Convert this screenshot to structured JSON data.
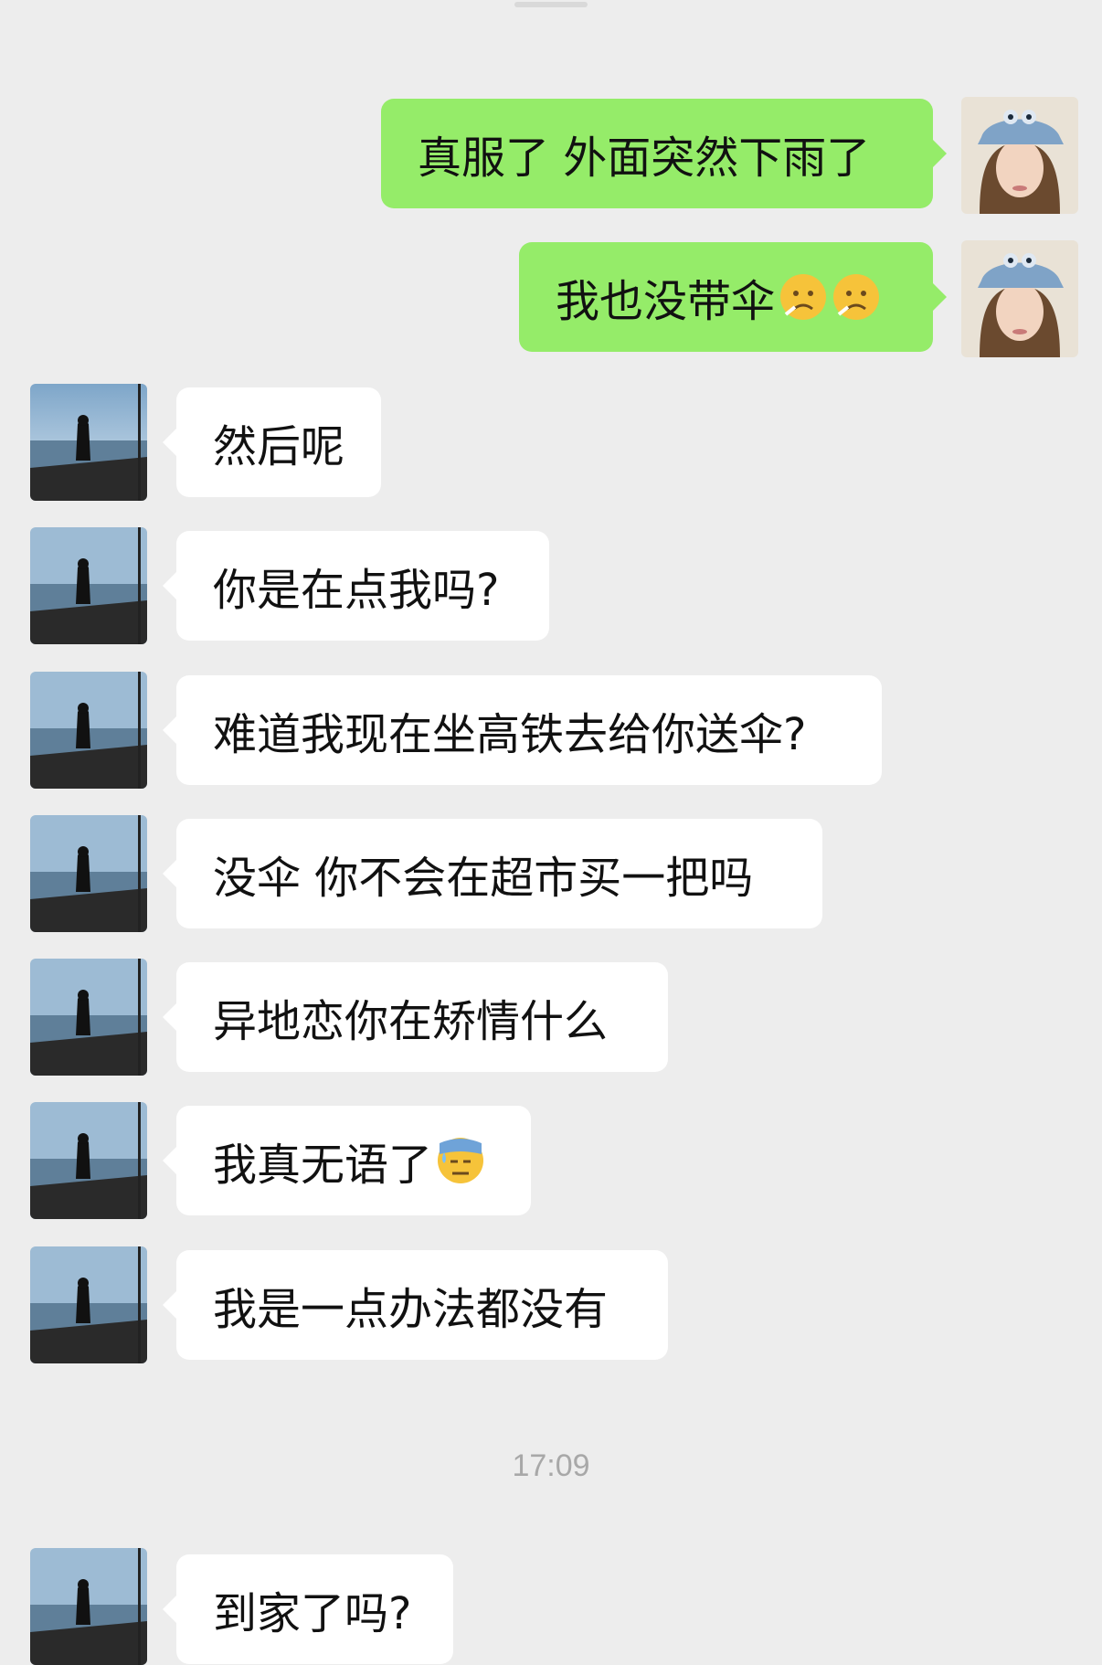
{
  "conversation": {
    "messages": [
      {
        "side": "sent",
        "text": "真服了 外面突然下雨了",
        "emojis": []
      },
      {
        "side": "sent",
        "text": "我也没带伞",
        "emojis": [
          "sad-face-emoji",
          "sad-face-emoji"
        ]
      },
      {
        "side": "recv",
        "text": "然后呢",
        "emojis": []
      },
      {
        "side": "recv",
        "text": "你是在点我吗?",
        "emojis": []
      },
      {
        "side": "recv",
        "text": "难道我现在坐高铁去给你送伞?",
        "emojis": []
      },
      {
        "side": "recv",
        "text": "没伞 你不会在超市买一把吗",
        "emojis": []
      },
      {
        "side": "recv",
        "text": "异地恋你在矫情什么",
        "emojis": []
      },
      {
        "side": "recv",
        "text": "我真无语了",
        "emojis": [
          "sweat-face-emoji"
        ]
      },
      {
        "side": "recv",
        "text": "我是一点办法都没有",
        "emojis": []
      },
      {
        "side": "recv",
        "text": "到家了吗?",
        "emojis": []
      }
    ],
    "timestamp": "17:09"
  },
  "colors": {
    "background": "#ededed",
    "sent_bubble": "#95ec69",
    "received_bubble": "#ffffff",
    "timestamp_text": "#a8a8a8"
  },
  "icons": {
    "sent_avatar": "woman-with-cap-avatar",
    "received_avatar": "person-on-deck-avatar"
  }
}
